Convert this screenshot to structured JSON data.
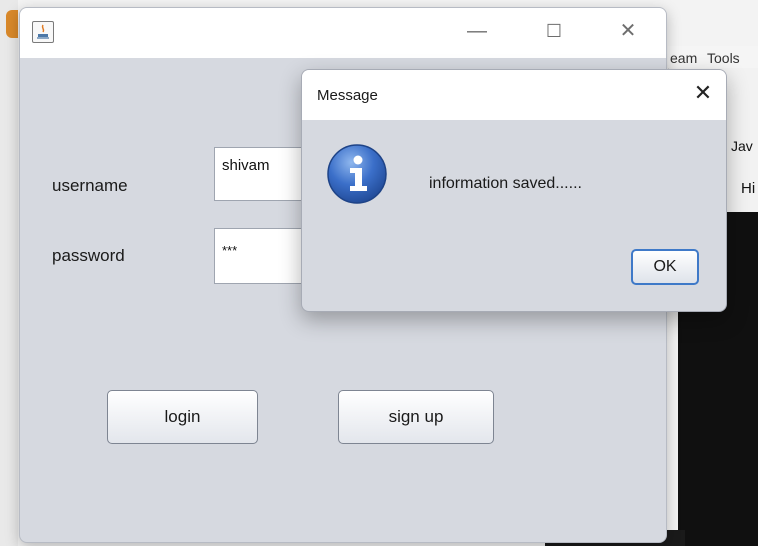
{
  "background_ide": {
    "menu_items": [
      "eam",
      "Tools"
    ],
    "tab_labels": [
      "Jav",
      "Hi"
    ]
  },
  "main_window": {
    "controls": {
      "minimize": "—",
      "maximize": "☐",
      "close": "✕"
    },
    "form": {
      "username_label": "username",
      "username_value": "shivam",
      "password_label": "password",
      "password_value": "***"
    },
    "buttons": {
      "login": "login",
      "signup": "sign up"
    }
  },
  "message_dialog": {
    "title": "Message",
    "close": "✕",
    "message": "information saved......",
    "ok_label": "OK",
    "icon": "info-icon",
    "accent_color": "#3e79c8"
  }
}
